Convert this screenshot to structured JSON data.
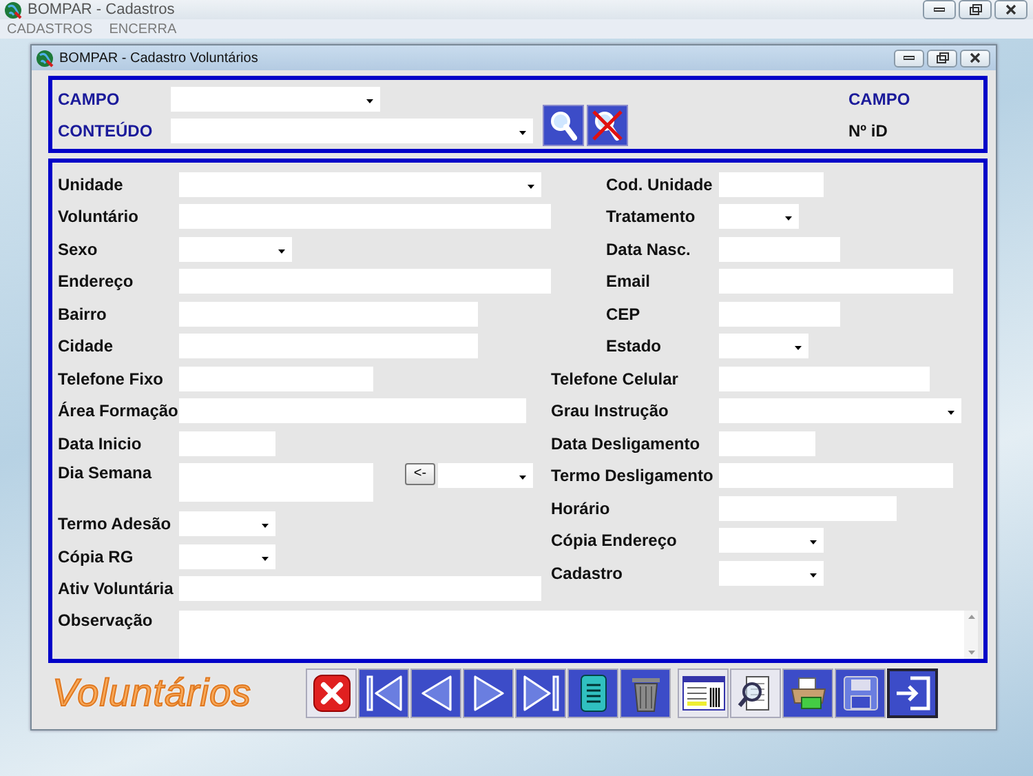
{
  "window": {
    "title": "BOMPAR - Cadastros"
  },
  "menu": [
    {
      "label": "CADASTROS"
    },
    {
      "label": "ENCERRA"
    }
  ],
  "child_window": {
    "title": "BOMPAR - Cadastro Voluntários"
  },
  "search_panel": {
    "field_label": "CAMPO",
    "content_label": "CONTEÚDO",
    "result_label": "CAMPO",
    "id_label": "Nº iD"
  },
  "form": {
    "left": [
      {
        "label": "Unidade",
        "kind": "select"
      },
      {
        "label": "Voluntário",
        "kind": "text"
      },
      {
        "label": "Sexo",
        "kind": "select"
      },
      {
        "label": "Endereço",
        "kind": "text"
      },
      {
        "label": "Bairro",
        "kind": "text"
      },
      {
        "label": "Cidade",
        "kind": "text"
      },
      {
        "label": "Telefone Fixo",
        "kind": "text"
      },
      {
        "label": "Área Formação",
        "kind": "text"
      },
      {
        "label": "Data Inicio",
        "kind": "text"
      },
      {
        "label": "Dia Semana",
        "kind": "weekday",
        "button_label": "<-"
      },
      {
        "label": "Termo Adesão",
        "kind": "select"
      },
      {
        "label": "Cópia RG",
        "kind": "select"
      },
      {
        "label": "Ativ Voluntária",
        "kind": "text"
      }
    ],
    "right": [
      {
        "label": "Cod. Unidade",
        "kind": "text"
      },
      {
        "label": "Tratamento",
        "kind": "select"
      },
      {
        "label": "Data Nasc.",
        "kind": "text"
      },
      {
        "label": "Email",
        "kind": "text"
      },
      {
        "label": "CEP",
        "kind": "text"
      },
      {
        "label": "Estado",
        "kind": "select"
      },
      {
        "label": "Telefone Celular",
        "kind": "text"
      },
      {
        "label": "Grau Instrução",
        "kind": "select"
      },
      {
        "label": "Data Desligamento",
        "kind": "text"
      },
      {
        "label": "Termo Desligamento",
        "kind": "text"
      },
      {
        "label": "Horário",
        "kind": "text"
      },
      {
        "label": "Cópia Endereço",
        "kind": "select"
      },
      {
        "label": "Cadastro",
        "kind": "select"
      }
    ],
    "notes": {
      "label": "Observação"
    }
  },
  "footer": {
    "title": "Voluntários"
  }
}
